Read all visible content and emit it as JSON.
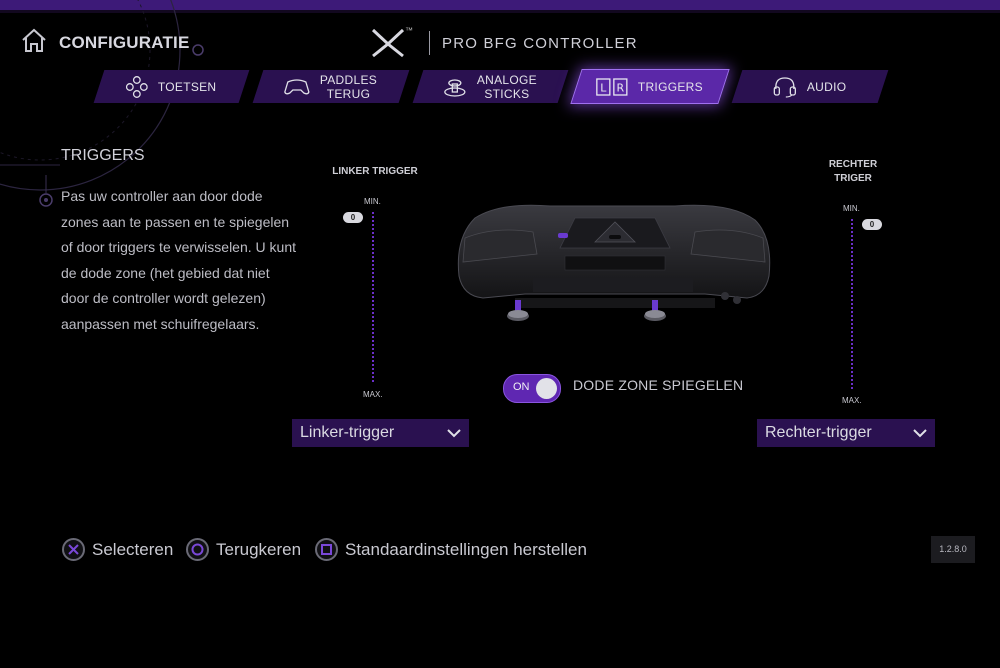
{
  "header": {
    "title": "CONFIGURATIE",
    "brand_tm": "™",
    "product": "PRO BFG CONTROLLER"
  },
  "tabs": [
    {
      "label": "TOETSEN",
      "icon": "dpad-icon",
      "active": false
    },
    {
      "label": "PADDLES\nTERUG",
      "icon": "controller-back-icon",
      "active": false
    },
    {
      "label": "ANALOGE\nSTICKS",
      "icon": "analog-stick-icon",
      "active": false
    },
    {
      "label": "TRIGGERS",
      "icon": "lr-triggers-icon",
      "active": true
    },
    {
      "label": "AUDIO",
      "icon": "headset-icon",
      "active": false
    }
  ],
  "section": {
    "title": "TRIGGERS",
    "description": "Pas uw controller aan door dode zones aan te passen en te spiegelen of door triggers te verwisselen. U kunt de dode zone (het gebied dat niet door de controller wordt gelezen) aanpassen met schuifregelaars."
  },
  "left_trigger": {
    "label": "LINKER TRIGGER",
    "min": "MIN.",
    "max": "MAX.",
    "value": "0",
    "dropdown": "Linker-trigger"
  },
  "right_trigger": {
    "label": "RECHTER\nTRIGER",
    "min": "MIN.",
    "max": "MAX.",
    "value": "0",
    "dropdown": "Rechter-trigger"
  },
  "mirror": {
    "toggle_state": "ON",
    "label": "DODE ZONE SPIEGELEN"
  },
  "footer": {
    "hints": [
      {
        "icon": "cross-button-icon",
        "label": "Selecteren"
      },
      {
        "icon": "circle-button-icon",
        "label": "Terugkeren"
      },
      {
        "icon": "square-button-icon",
        "label": "Standaardinstellingen herstellen"
      }
    ],
    "version": "1.2.8.0"
  },
  "colors": {
    "accent": "#5b28a8",
    "tab_bg": "#2a1150",
    "track": "#6a2fc8",
    "top_bar": "#3d1a78"
  }
}
